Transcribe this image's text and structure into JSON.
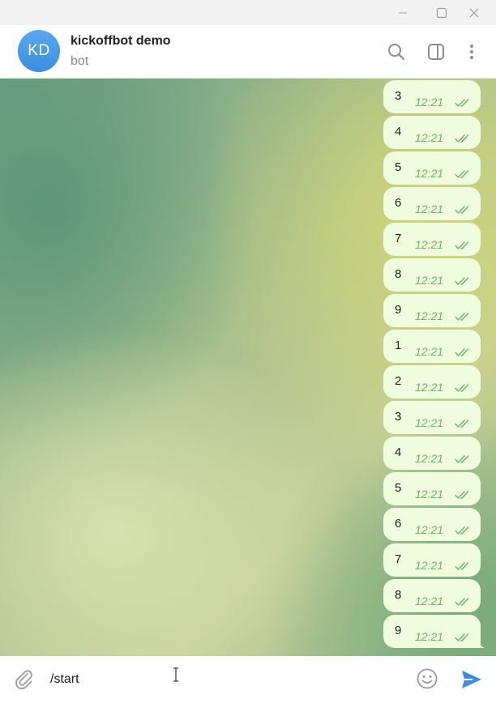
{
  "window": {
    "controls": [
      "minimize-icon",
      "maximize-icon",
      "close-icon"
    ]
  },
  "header": {
    "avatar_initials": "KD",
    "title": "kickoffbot demo",
    "subtitle": "bot",
    "icons": [
      "search-icon",
      "sidebar-toggle-icon",
      "more-vertical-icon"
    ]
  },
  "messages": [
    {
      "text": "3",
      "time": "12:21"
    },
    {
      "text": "4",
      "time": "12:21"
    },
    {
      "text": "5",
      "time": "12:21"
    },
    {
      "text": "6",
      "time": "12:21"
    },
    {
      "text": "7",
      "time": "12:21"
    },
    {
      "text": "8",
      "time": "12:21"
    },
    {
      "text": "9",
      "time": "12:21"
    },
    {
      "text": "1",
      "time": "12:21"
    },
    {
      "text": "2",
      "time": "12:21"
    },
    {
      "text": "3",
      "time": "12:21"
    },
    {
      "text": "4",
      "time": "12:21"
    },
    {
      "text": "5",
      "time": "12:21"
    },
    {
      "text": "6",
      "time": "12:21"
    },
    {
      "text": "7",
      "time": "12:21"
    },
    {
      "text": "8",
      "time": "12:21"
    },
    {
      "text": "9",
      "time": "12:21"
    }
  ],
  "composer": {
    "input_value": "/start",
    "icons": [
      "attach-icon",
      "emoji-icon",
      "send-icon"
    ]
  },
  "colors": {
    "accent": "#3d8fde",
    "bubble": "#effdde",
    "time_and_checks": "#6fb36a"
  }
}
